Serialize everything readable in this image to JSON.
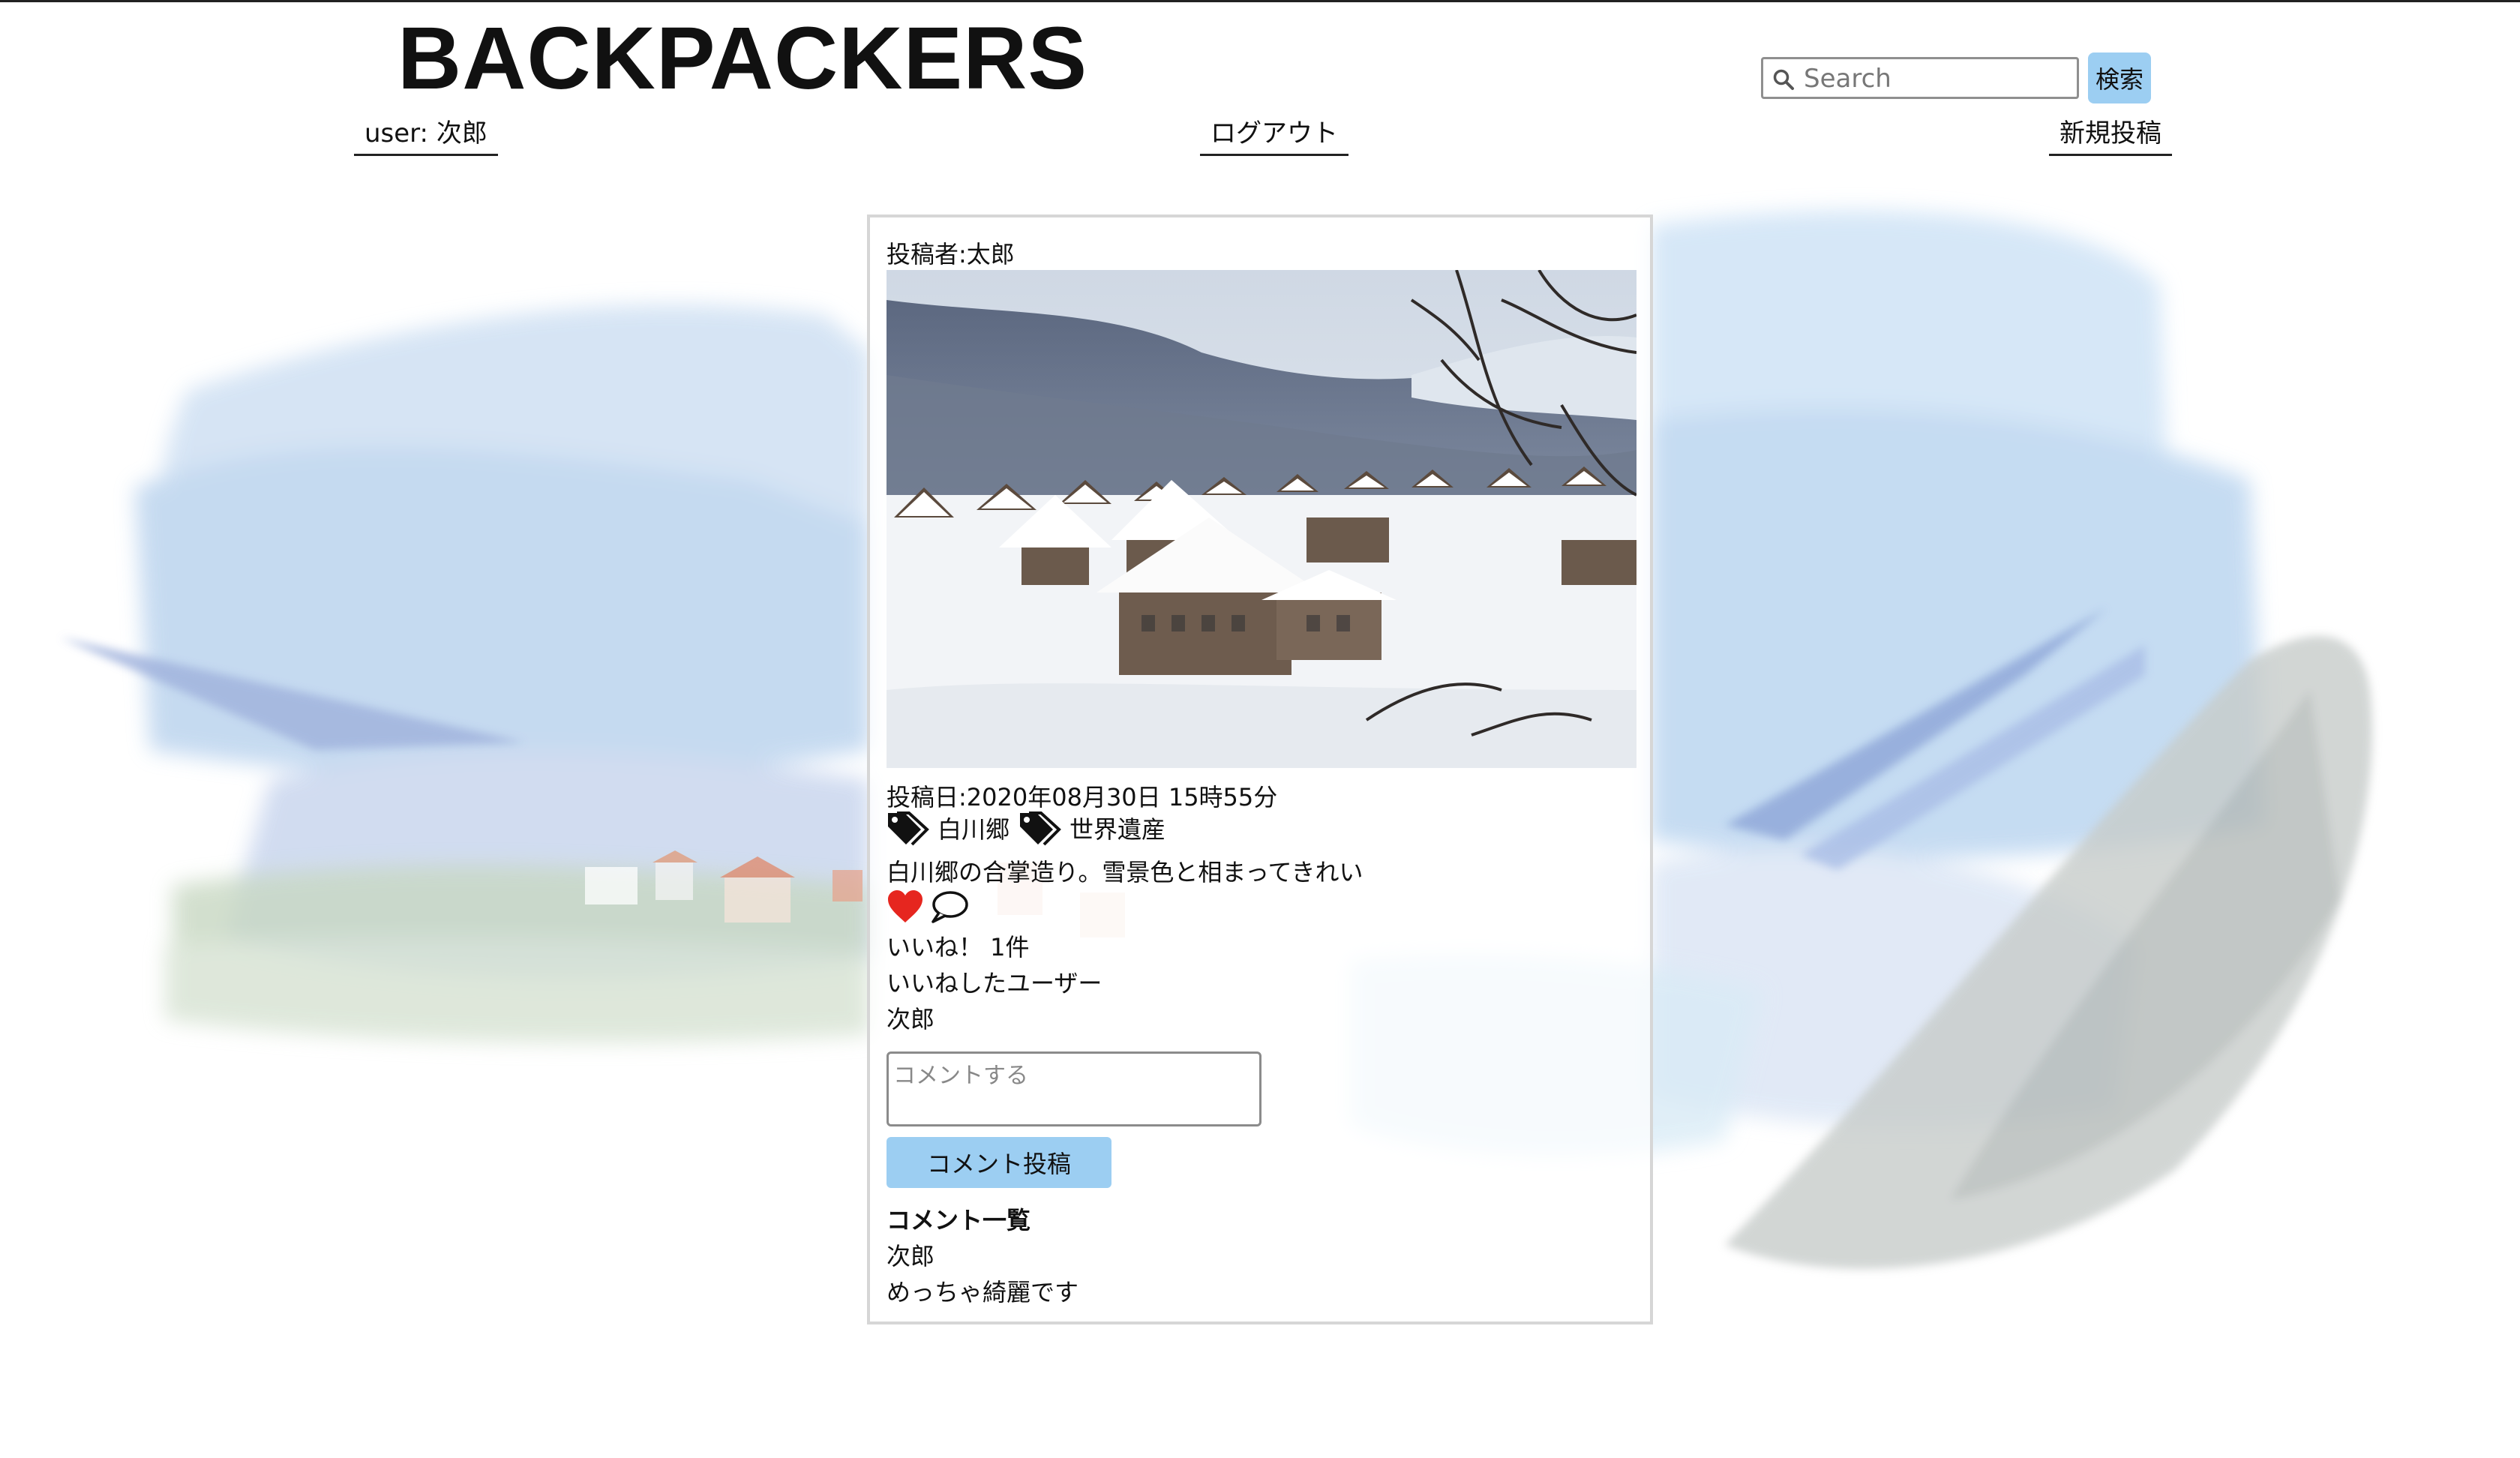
{
  "header": {
    "logo": "BACKPACKERS",
    "user_label": "user: 次郎",
    "logout_label": "ログアウト",
    "new_post_label": "新規投稿",
    "search": {
      "placeholder": "Search",
      "value": "",
      "button_label": "検索"
    }
  },
  "post": {
    "author": "投稿者:太郎",
    "date": "投稿日:2020年08月30日 15時55分",
    "tags": [
      "白川郷",
      "世界遺産"
    ],
    "body": "白川郷の合掌造り。雪景色と相まってきれい",
    "likes_count": "いいね！ 1件",
    "likers_title": "いいねしたユーザー",
    "likers": [
      "次郎"
    ],
    "comment_placeholder": "コメントする",
    "comment_button": "コメント投稿",
    "comments_title": "コメント一覧",
    "comments": [
      {
        "user": "次郎",
        "text": "めっちゃ綺麗です"
      }
    ]
  },
  "icons": {
    "search": "search-icon",
    "tag": "tag-icon",
    "like": "heart-icon",
    "comment": "speech-bubble-icon"
  },
  "colors": {
    "button": "#9ccef2",
    "heart": "#e6261f",
    "text": "#111111"
  }
}
